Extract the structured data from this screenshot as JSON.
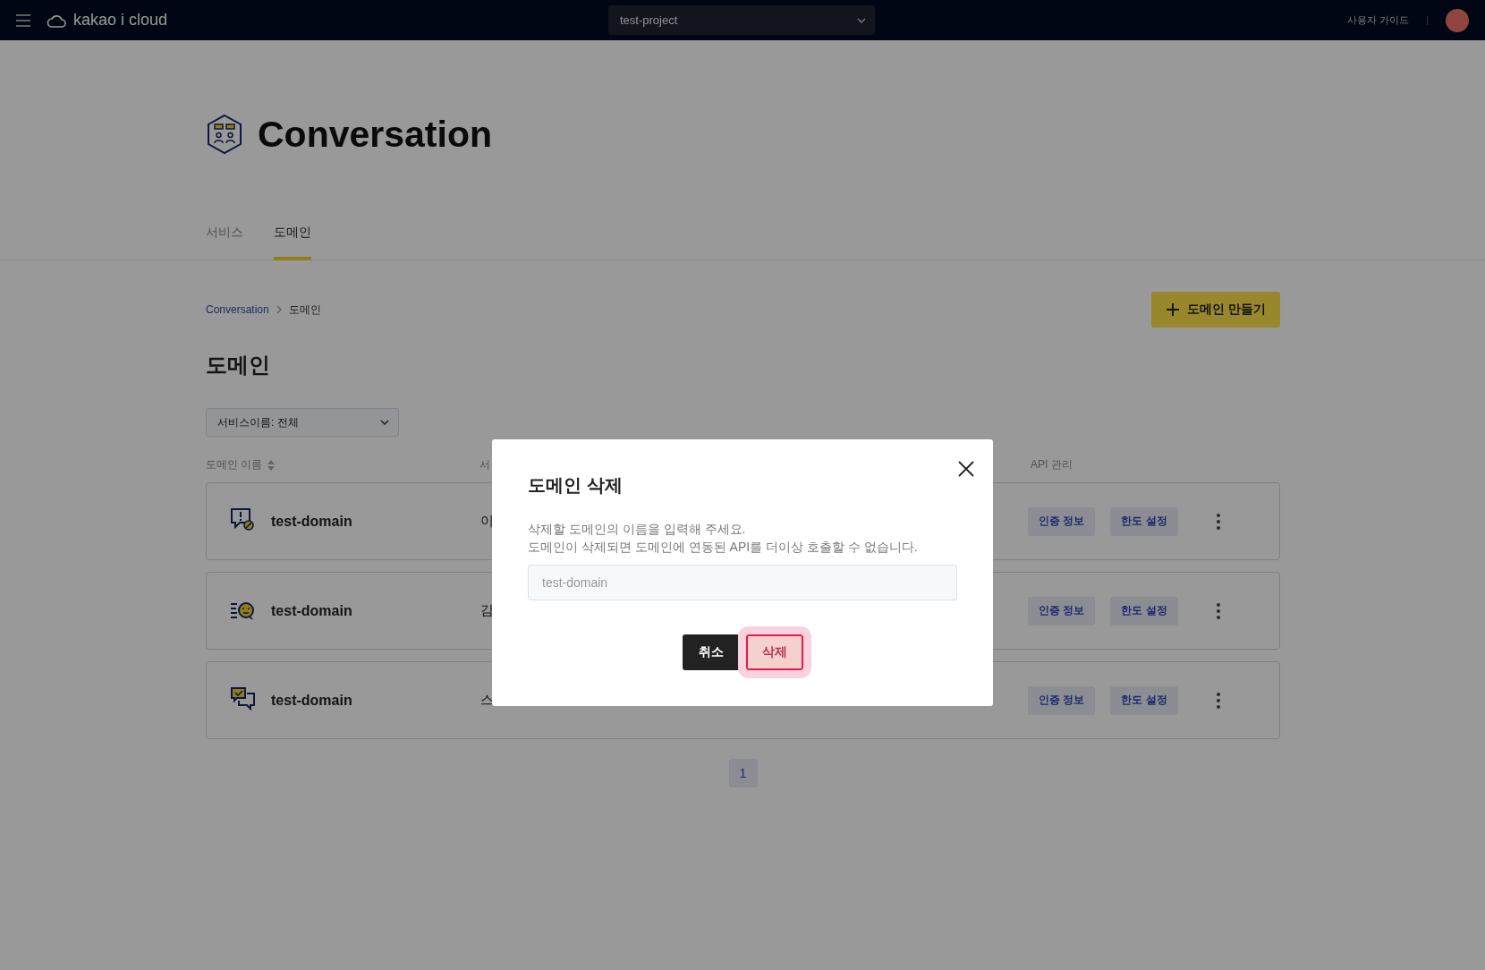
{
  "top_bar": {
    "brand": "kakao i cloud",
    "project_select": {
      "value": "test-project"
    },
    "user_guide": "사용자 가이드"
  },
  "header": {
    "title": "Conversation"
  },
  "tabs": [
    {
      "label": "서비스",
      "selected": false
    },
    {
      "label": "도메인",
      "selected": true
    }
  ],
  "breadcrumb": [
    {
      "label": "Conversation",
      "kind": "link"
    },
    {
      "label": "도메인",
      "kind": "current"
    }
  ],
  "create_button": "도메인 만들기",
  "section_title": "도메인",
  "filter_select": {
    "value": "서비스이름: 전체"
  },
  "table": {
    "columns": [
      "도메인 이름",
      "서",
      "API 관리"
    ],
    "rows": [
      {
        "name": "test-domain",
        "column_2": "이",
        "actions": [
          "인증 정보",
          "한도 설정"
        ]
      },
      {
        "name": "test-domain",
        "column_2": "감",
        "actions": [
          "인증 정보",
          "한도 설정"
        ]
      },
      {
        "name": "test-domain",
        "column_2": "스",
        "actions": [
          "인증 정보",
          "한도 설정"
        ]
      }
    ]
  },
  "pagination": [
    {
      "label": "1",
      "selected": true
    }
  ],
  "dialog": {
    "title": "도메인 삭제",
    "message": [
      "삭제할 도메인의 이름을 입력해 주세요.",
      "도메인이 삭제되면 도메인에 연동된 API를 더이상 호출할 수 없습니다."
    ],
    "input": {
      "placeholder": "test-domain"
    },
    "buttons": [
      {
        "label": "취소",
        "kind": "secondary",
        "disabled": false,
        "focused": false
      },
      {
        "label": "삭제",
        "kind": "danger",
        "disabled": true,
        "focused": true
      }
    ]
  }
}
